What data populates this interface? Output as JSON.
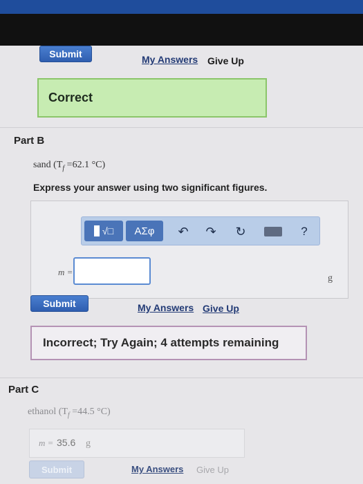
{
  "part_a": {
    "submit_label": "Submit",
    "my_answers_label": "My Answers",
    "give_up_label": "Give Up",
    "feedback_text": "Correct"
  },
  "part_b": {
    "label": "Part B",
    "question_prefix": "sand (T",
    "question_sub": "f",
    "question_value": " =62.1 °C)",
    "instruction": "Express your answer using two significant figures.",
    "toolbar": {
      "template_icon_label": "√□",
      "greek_label": "ΑΣφ",
      "help_label": "?"
    },
    "answer_var_label": "m =",
    "answer_value": "",
    "unit": "g",
    "submit_label": "Submit",
    "my_answers_label": "My Answers",
    "give_up_label": "Give Up",
    "feedback_text": "Incorrect; Try Again; 4 attempts remaining"
  },
  "part_c": {
    "label": "Part C",
    "question_prefix": "ethanol (T",
    "question_sub": "f",
    "question_value": " =44.5 °C)",
    "answer_var_label": "m =",
    "answer_value": "35.6",
    "unit": "g",
    "submit_label": "Submit",
    "my_answers_label": "My Answers",
    "give_up_label": "Give Up"
  },
  "colors": {
    "correct_bg": "#c7ecb2",
    "incorrect_border": "#b492b4",
    "button_blue": "#2f5eb0",
    "toolbar_bg": "#b9cde8"
  }
}
